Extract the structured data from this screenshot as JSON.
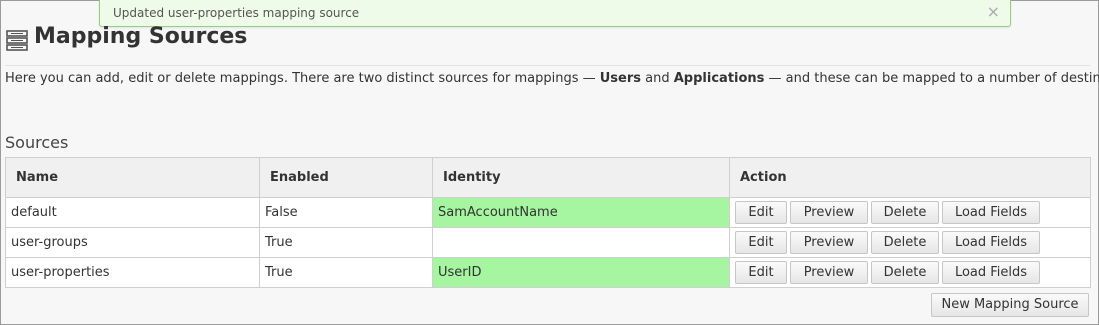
{
  "toast": {
    "message": "Updated user-properties mapping source",
    "close_glyph": "×"
  },
  "header": {
    "icon": "mapping-list-icon",
    "title": "Mapping Sources"
  },
  "description": {
    "part1": "Here you can add, edit or delete mappings. There are two distinct sources for mappings — ",
    "users": "Users",
    "part2": " and ",
    "applications": "Applications",
    "part3": " — and these can be mapped to a number of destinations."
  },
  "sources": {
    "title": "Sources",
    "columns": [
      "Name",
      "Enabled",
      "Identity",
      "Action"
    ],
    "rows": [
      {
        "name": "default",
        "enabled": "False",
        "identity": "SamAccountName"
      },
      {
        "name": "user-groups",
        "enabled": "True",
        "identity": ""
      },
      {
        "name": "user-properties",
        "enabled": "True",
        "identity": "UserID"
      }
    ],
    "actions": {
      "edit": "Edit",
      "preview": "Preview",
      "delete": "Delete",
      "load_fields": "Load Fields"
    },
    "new_button": "New Mapping Source"
  },
  "colors": {
    "identity_highlight": "#a6f5a0",
    "toast_border": "#8fd17d",
    "toast_background": "#eefbe9"
  }
}
